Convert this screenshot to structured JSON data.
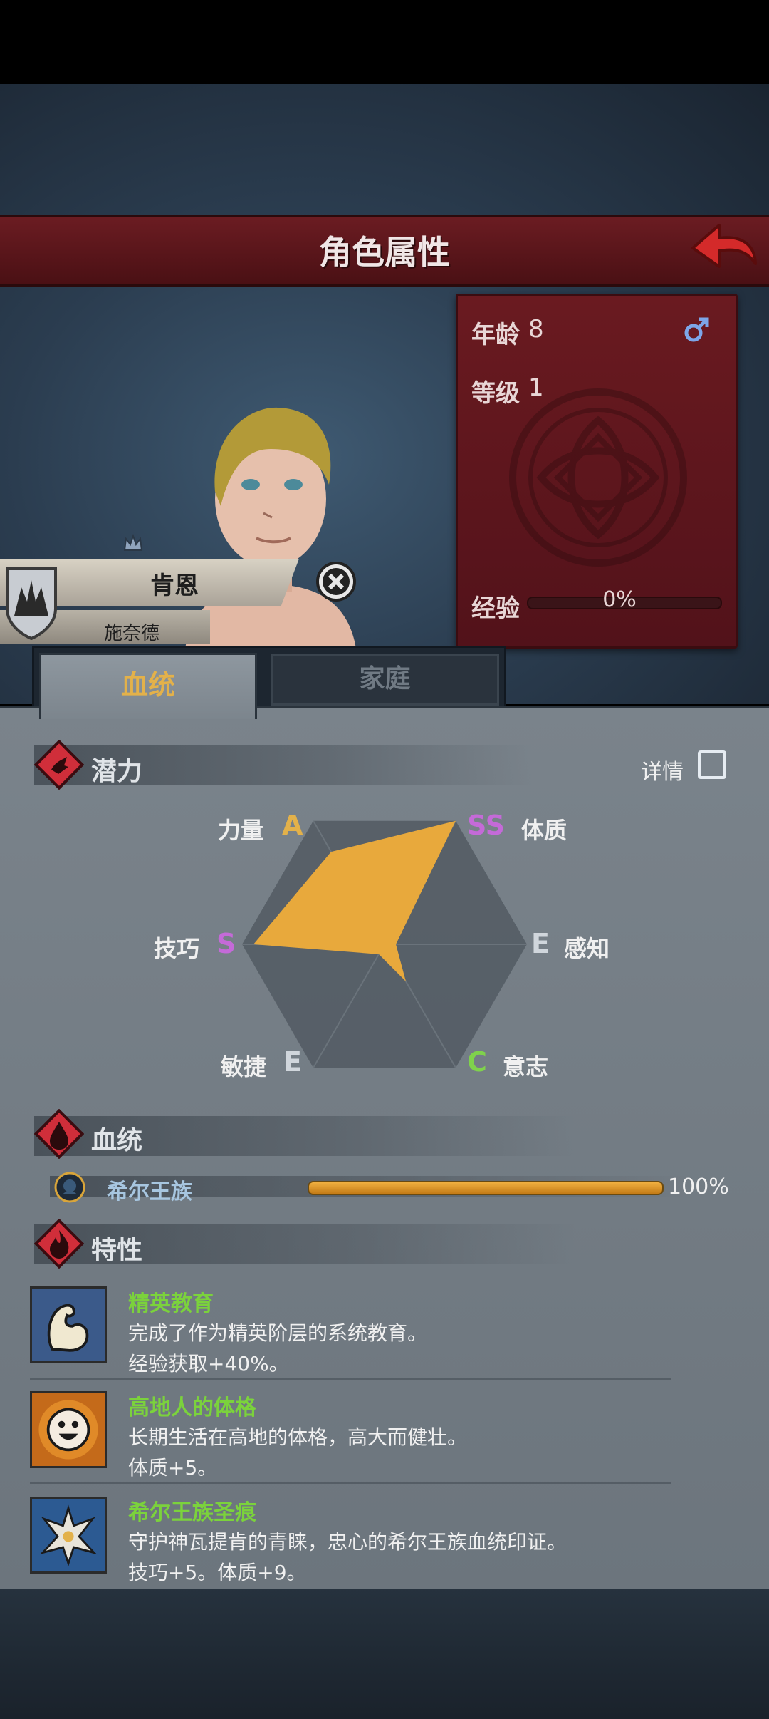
{
  "header": {
    "title": "角色属性"
  },
  "stats": {
    "age_label": "年龄",
    "age_value": "8",
    "level_label": "等级",
    "level_value": "1",
    "exp_label": "经验",
    "exp_value": "0%",
    "gender_icon": "male-symbol-icon"
  },
  "character": {
    "name": "肯恩",
    "family": "施奈德"
  },
  "tabs": [
    {
      "label": "血统",
      "active": true
    },
    {
      "label": "家庭",
      "active": false
    }
  ],
  "potential": {
    "title": "潜力",
    "detail_label": "详情",
    "axes": [
      {
        "name": "力量",
        "grade": "A",
        "color": "#e3b14a"
      },
      {
        "name": "体质",
        "grade": "SS",
        "color": "#c46ad8"
      },
      {
        "name": "感知",
        "grade": "E",
        "color": "#d0d6dc"
      },
      {
        "name": "意志",
        "grade": "C",
        "color": "#7fd24c"
      },
      {
        "name": "敏捷",
        "grade": "E",
        "color": "#d0d6dc"
      },
      {
        "name": "技巧",
        "grade": "S",
        "color": "#c46ad8"
      }
    ]
  },
  "lineage": {
    "title": "血统",
    "items": [
      {
        "name": "希尔王族",
        "percent": "100%",
        "fill": 1.0
      }
    ]
  },
  "traits": {
    "title": "特性",
    "items": [
      {
        "name": "精英教育",
        "desc": "完成了作为精英阶层的系统教育。",
        "effect": "经验获取+40%。",
        "icon": "arm-muscle-icon"
      },
      {
        "name": "高地人的体格",
        "desc": "长期生活在高地的体格，高大而健壮。",
        "effect": "体质+5。",
        "icon": "smiley-sun-icon"
      },
      {
        "name": "希尔王族圣痕",
        "desc": "守护神瓦提肯的青睐，忠心的希尔王族血统印证。",
        "effect": "技巧+5。体质+9。",
        "icon": "wolf-claw-icon"
      }
    ]
  },
  "colors": {
    "accent": "#e3b14a",
    "header_red": "#6b1c22",
    "trait_green": "#7bd23c"
  }
}
